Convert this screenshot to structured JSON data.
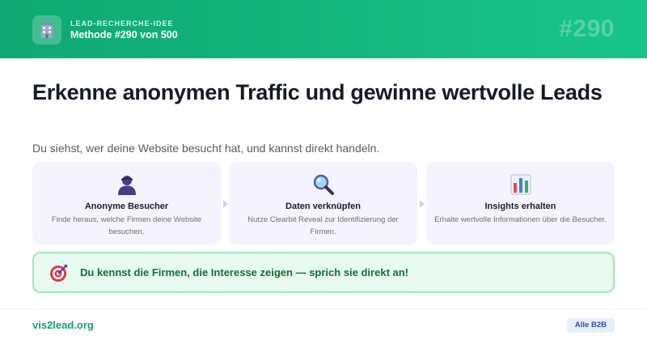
{
  "header": {
    "kicker": "LEAD-RECHERCHE-IDEE",
    "subtitle": "Methode #290 von 500",
    "number": "#290",
    "logo_icon": "building-icon"
  },
  "main": {
    "title": "Erkenne anonymen Traffic und gewinne wertvolle Leads",
    "subtitle": "Du siehst, wer deine Website besucht hat, und kannst direkt handeln."
  },
  "steps": [
    {
      "icon": "person-silhouette-icon",
      "title": "Anonyme Besucher",
      "desc": "Finde heraus, welche Firmen deine Website besuchen."
    },
    {
      "icon": "magnifier-icon",
      "title": "Daten verknüpfen",
      "desc": "Nutze Clearbit Reveal zur Identifizierung der Firmen."
    },
    {
      "icon": "bar-chart-icon",
      "title": "Insights erhalten",
      "desc": "Erhalte wertvolle Informationen über die Besucher."
    }
  ],
  "callout": {
    "icon": "target-dart-icon",
    "text": "Du kennst die Firmen, die Interesse zeigen — sprich sie direkt an!"
  },
  "footer": {
    "link": "vis2lead.org",
    "badge": "Alle B2B"
  },
  "colors": {
    "header_green": "#14b87f",
    "card_bg": "#f5f3fd",
    "callout_bg": "#e9fbf0",
    "callout_text": "#166b3d",
    "link_green": "#12a56e"
  }
}
